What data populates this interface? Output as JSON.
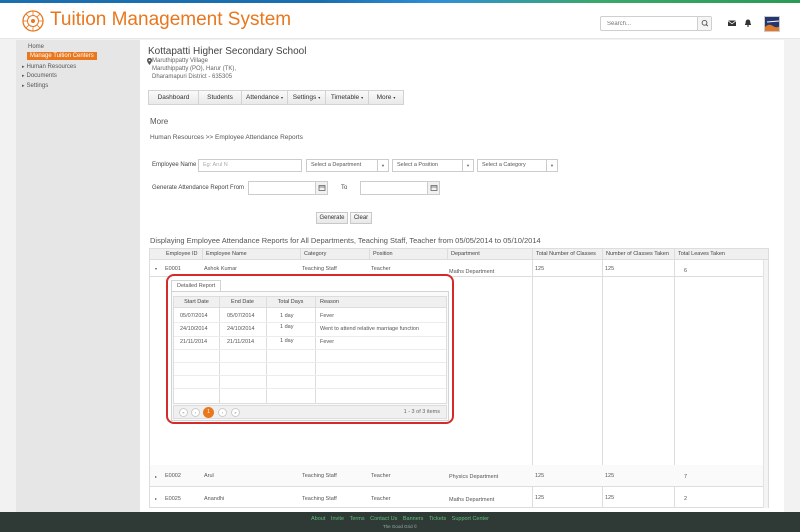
{
  "header": {
    "title": "Tuition Management System",
    "search_placeholder": "Search..."
  },
  "icons": {
    "search": "search-icon",
    "mail": "mail-icon",
    "bell": "bell-icon",
    "logo": "chakra-logo-icon"
  },
  "colors": {
    "brand": "#e8771e",
    "highlight": "#d32b2b",
    "footer_bg": "#2f3a36",
    "footer_link": "#5fbf7a"
  },
  "sidebar": {
    "items": [
      {
        "label": "Home",
        "arrow": ""
      },
      {
        "label": "Manage Tuition Centers",
        "arrow": ""
      },
      {
        "label": "Human Resources",
        "arrow": "▸"
      },
      {
        "label": "Documents",
        "arrow": "▸"
      },
      {
        "label": "Settings",
        "arrow": "▸"
      }
    ]
  },
  "school": {
    "name": "Kottapatti Higher Secondary School",
    "address": [
      "Maruthippatty Village",
      "Maruthippatty (PO), Harur (TK),",
      "Dharamapuri District - 635305"
    ]
  },
  "menu": [
    {
      "label": "Dashboard",
      "caret": ""
    },
    {
      "label": "Students",
      "caret": ""
    },
    {
      "label": "Attendance",
      "caret": "▾"
    },
    {
      "label": "Settings",
      "caret": "▾"
    },
    {
      "label": "Timetable",
      "caret": "▾"
    },
    {
      "label": "More",
      "caret": "▾"
    }
  ],
  "page": {
    "title": "More",
    "breadcrumb": "Human Resources >> Employee Attendance Reports"
  },
  "filters": {
    "employee_name_label": "Employee Name",
    "employee_name_placeholder": "Eg: Arul N",
    "department": "Select a Department",
    "position": "Select a Position",
    "category": "Select a Category",
    "generate_from_label": "Generate Attendance Report From",
    "to_label": "To",
    "generate_button": "Generate",
    "clear_button": "Clear"
  },
  "summary": "Displaying Employee Attendance Reports  for All Departments, Teaching Staff, Teacher from 05/05/2014 to 05/10/2014",
  "grid": {
    "columns": [
      "Employee ID",
      "Employee Name",
      "Category",
      "Position",
      "Department",
      "Total Number of Classes",
      "Number of Classes Taken",
      "Total Leaves Taken"
    ],
    "rows": [
      {
        "id": "E0001",
        "name": "Ashok Kumar",
        "category": "Teaching Staff",
        "position": "Teacher",
        "department": "Maths Department",
        "total": "125",
        "taken": "125",
        "leaves": "6"
      },
      {
        "id": "E0002",
        "name": "Arul",
        "category": "Teaching Staff",
        "position": "Teacher",
        "department": "Physics Department",
        "total": "125",
        "taken": "125",
        "leaves": "7"
      },
      {
        "id": "E0025",
        "name": "Anandhi",
        "category": "Teaching Staff",
        "position": "Teacher",
        "department": "Maths Department",
        "total": "125",
        "taken": "125",
        "leaves": "2"
      }
    ]
  },
  "detail": {
    "tab": "Detailed Report",
    "columns": [
      "Start Date",
      "End Date",
      "Total Days",
      "Reason"
    ],
    "rows": [
      {
        "start": "05/07/2014",
        "end": "05/07/2014",
        "days": "1 day",
        "reason": "Fever"
      },
      {
        "start": "24/10/2014",
        "end": "24/10/2014",
        "days": "1 day",
        "reason": "Went to attend relative marriage function"
      },
      {
        "start": "21/11/2014",
        "end": "21/11/2014",
        "days": "1 day",
        "reason": "Fever"
      }
    ],
    "pager": {
      "first": "«",
      "prev": "‹",
      "current": "1",
      "next": "›",
      "last": "»",
      "info": "1 - 3 of 3 items"
    }
  },
  "footer": {
    "links": [
      "About",
      "Invite",
      "Terms",
      "Contact Us",
      "Banners",
      "Tickets",
      "Support Center"
    ],
    "copyright": "The Good Grid ©"
  }
}
